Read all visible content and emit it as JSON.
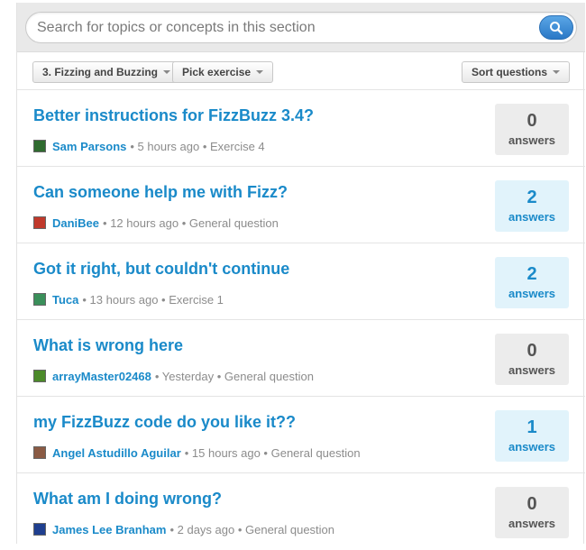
{
  "search": {
    "placeholder": "Search for topics or concepts in this section"
  },
  "toolbar": {
    "section_label": "3. Fizzing and Buzzing",
    "exercise_label": "Pick exercise",
    "sort_label": "Sort questions"
  },
  "colors": {
    "link": "#1a8ac9",
    "answered_bg": "#e1f3fb",
    "unanswered_bg": "#ececec"
  },
  "questions": [
    {
      "title": "Better instructions for FizzBuzz 3.4?",
      "author": "Sam Parsons",
      "meta": "• 5 hours ago • Exercise 4",
      "answers": "0",
      "answers_label": "answers",
      "avatar_color": "#2f6b2f"
    },
    {
      "title": "Can someone help me with Fizz?",
      "author": "DaniBee",
      "meta": "• 12 hours ago • General question",
      "answers": "2",
      "answers_label": "answers",
      "avatar_color": "#c0392b"
    },
    {
      "title": "Got it right, but couldn't continue",
      "author": "Tuca",
      "meta": "• 13 hours ago • Exercise 1",
      "answers": "2",
      "answers_label": "answers",
      "avatar_color": "#3a8f5a"
    },
    {
      "title": "What is wrong here",
      "author": "arrayMaster02468",
      "meta": "• Yesterday • General question",
      "answers": "0",
      "answers_label": "answers",
      "avatar_color": "#4c8a2a"
    },
    {
      "title": "my FizzBuzz code do you like it??",
      "author": "Angel Astudillo Aguilar",
      "meta": "• 15 hours ago • General question",
      "answers": "1",
      "answers_label": "answers",
      "avatar_color": "#8a5a44"
    },
    {
      "title": "What am I doing wrong?",
      "author": "James Lee Branham",
      "meta": "• 2 days ago • General question",
      "answers": "0",
      "answers_label": "answers",
      "avatar_color": "#1f3f8f"
    }
  ]
}
